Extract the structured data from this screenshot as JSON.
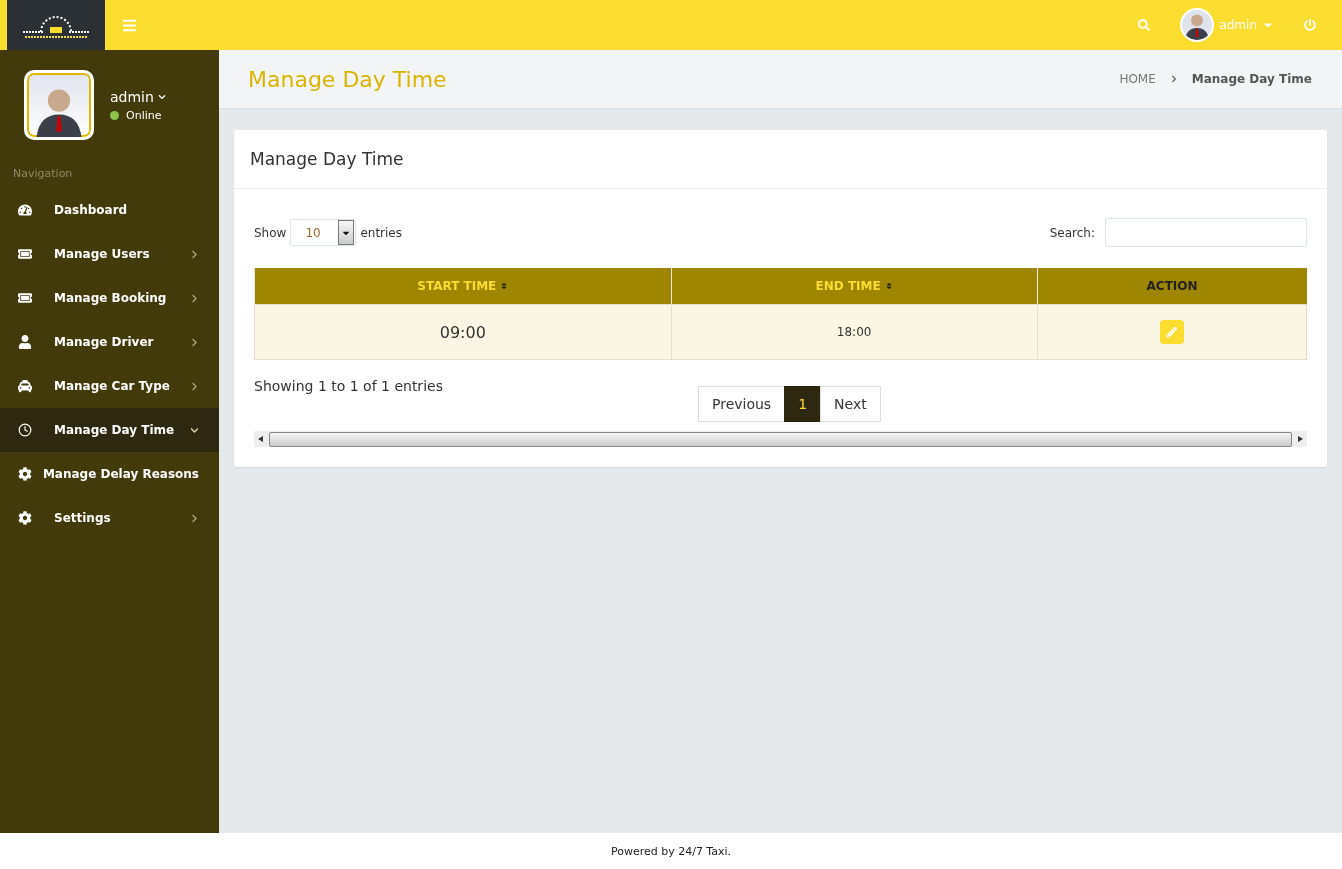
{
  "topbar": {
    "user": {
      "name": "admin"
    }
  },
  "sidebar": {
    "user": {
      "name": "admin",
      "status": "Online",
      "online": true
    },
    "section_title": "Navigation",
    "items": [
      {
        "label": "Dashboard",
        "kind": "dashboard",
        "has_submenu": false,
        "selected": false
      },
      {
        "label": "Manage Users",
        "kind": "ticket",
        "has_submenu": true,
        "expanded": false,
        "selected": false
      },
      {
        "label": "Manage Booking",
        "kind": "ticket",
        "has_submenu": true,
        "expanded": false,
        "selected": false
      },
      {
        "label": "Manage Driver",
        "kind": "user",
        "has_submenu": true,
        "expanded": false,
        "selected": false
      },
      {
        "label": "Manage Car Type",
        "kind": "car",
        "has_submenu": true,
        "expanded": false,
        "selected": false
      },
      {
        "label": "Manage Day Time",
        "kind": "clock",
        "has_submenu": true,
        "expanded": true,
        "selected": true
      },
      {
        "label": "Manage Delay Reasons",
        "kind": "gear",
        "has_submenu": false,
        "selected": false
      },
      {
        "label": "Settings",
        "kind": "gear",
        "has_submenu": true,
        "expanded": false,
        "selected": false
      }
    ]
  },
  "page_header": {
    "title": "Manage Day Time",
    "breadcrumb": [
      "HOME",
      "Manage Day Time"
    ]
  },
  "card": {
    "title": "Manage Day Time",
    "length": {
      "before": "Show",
      "value": "10",
      "after": "entries"
    },
    "search": {
      "label": "Search:"
    },
    "table": {
      "columns": [
        {
          "label": "START TIME",
          "sortable": true
        },
        {
          "label": "END TIME",
          "sortable": true
        },
        {
          "label": "ACTION",
          "sortable": false
        }
      ],
      "rows": [
        {
          "start": "09:00",
          "end": "18:00"
        }
      ]
    },
    "info": "Showing 1 to 1 of 1 entries",
    "pagination": [
      {
        "label": "Previous",
        "selected": false
      },
      {
        "label": "1",
        "selected": true
      },
      {
        "label": "Next",
        "selected": false
      }
    ]
  },
  "footer": "Powered by 24/7 Taxi."
}
